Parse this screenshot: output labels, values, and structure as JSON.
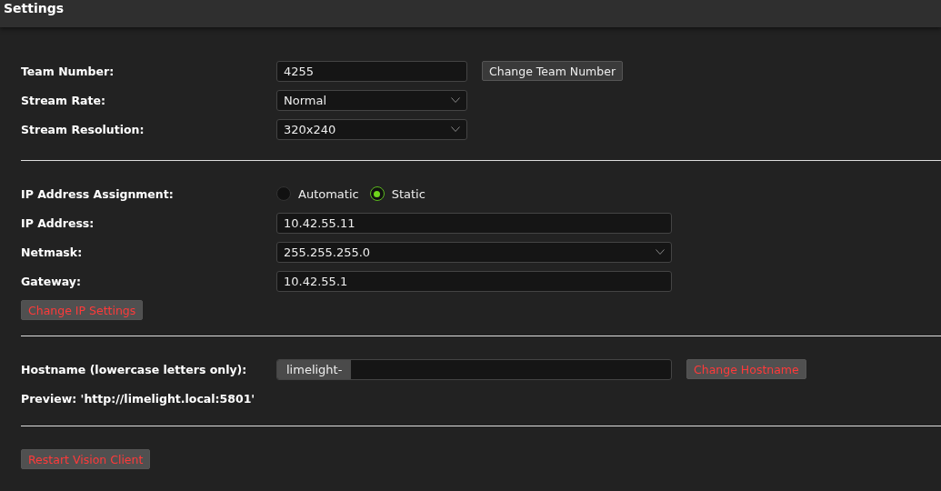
{
  "header": {
    "title": "Settings"
  },
  "stream": {
    "team_number": {
      "label": "Team Number:",
      "value": "4255",
      "button": "Change Team Number"
    },
    "rows": [
      {
        "label": "Stream Rate:",
        "value": "Normal"
      },
      {
        "label": "Stream Resolution:",
        "value": "320x240"
      }
    ]
  },
  "network": {
    "assignment": {
      "label": "IP Address Assignment:",
      "options": [
        {
          "label": "Automatic",
          "selected": false
        },
        {
          "label": "Static",
          "selected": true
        }
      ]
    },
    "fields": [
      {
        "kind": "text",
        "label": "IP Address:",
        "value": "10.42.55.11"
      },
      {
        "kind": "select",
        "label": "Netmask:",
        "value": "255.255.255.0"
      },
      {
        "kind": "text",
        "label": "Gateway:",
        "value": "10.42.55.1"
      }
    ],
    "button": "Change IP Settings"
  },
  "hostname": {
    "label": "Hostname (lowercase letters only):",
    "prefix": "limelight-",
    "button": "Change Hostname",
    "preview": "Preview: 'http://limelight.local:5801'"
  },
  "restart_button": "Restart Vision Client"
}
